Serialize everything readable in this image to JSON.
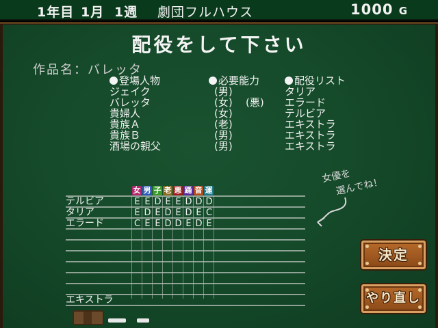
{
  "status": {
    "year": "1年目",
    "month": "1月",
    "week": "1週",
    "troupe": "劇団フルハウス",
    "money": "1000",
    "money_unit": "G"
  },
  "title": "配役をして下さい",
  "work_label": "作品名：バレッタ",
  "roles_header": "登場人物",
  "ability_header": "必要能力",
  "cast_header": "配役リスト",
  "roles": [
    {
      "name": "ジェイク",
      "ability": "(男)",
      "extra": "",
      "cast": "タリア"
    },
    {
      "name": "バレッタ",
      "ability": "(女)",
      "extra": "(悪)",
      "cast": "エラード"
    },
    {
      "name": "貴婦人",
      "ability": "(女)",
      "extra": "",
      "cast": "テルビア"
    },
    {
      "name": "貴族Ａ",
      "ability": "(老)",
      "extra": "",
      "cast": "エキストラ"
    },
    {
      "name": "貴族Ｂ",
      "ability": "(男)",
      "extra": "",
      "cast": "エキストラ"
    },
    {
      "name": "酒場の親父",
      "ability": "(男)",
      "extra": "",
      "cast": "エキストラ"
    }
  ],
  "note": {
    "line1": "女優を",
    "line2": "選んでね！"
  },
  "grid": {
    "columns": [
      {
        "label": "女",
        "color": "#b0286e"
      },
      {
        "label": "男",
        "color": "#2a58b8"
      },
      {
        "label": "子",
        "color": "#3a9a2a"
      },
      {
        "label": "老",
        "color": "#8a6a1a"
      },
      {
        "label": "悪",
        "color": "#a01818"
      },
      {
        "label": "踊",
        "color": "#5a2a9a"
      },
      {
        "label": "音",
        "color": "#b04a18"
      },
      {
        "label": "運",
        "color": "#1a7a8a"
      }
    ],
    "actors": [
      {
        "name": "テルビア",
        "grades": [
          "E",
          "E",
          "D",
          "E",
          "E",
          "D",
          "D",
          "D"
        ]
      },
      {
        "name": "タリア",
        "grades": [
          "E",
          "D",
          "E",
          "D",
          "E",
          "D",
          "E",
          "C"
        ]
      },
      {
        "name": "エラード",
        "grades": [
          "C",
          "E",
          "E",
          "D",
          "D",
          "E",
          "D",
          "E"
        ]
      }
    ],
    "extra_label": "エキストラ"
  },
  "buttons": {
    "decide": "決定",
    "redo": "やり直し"
  }
}
